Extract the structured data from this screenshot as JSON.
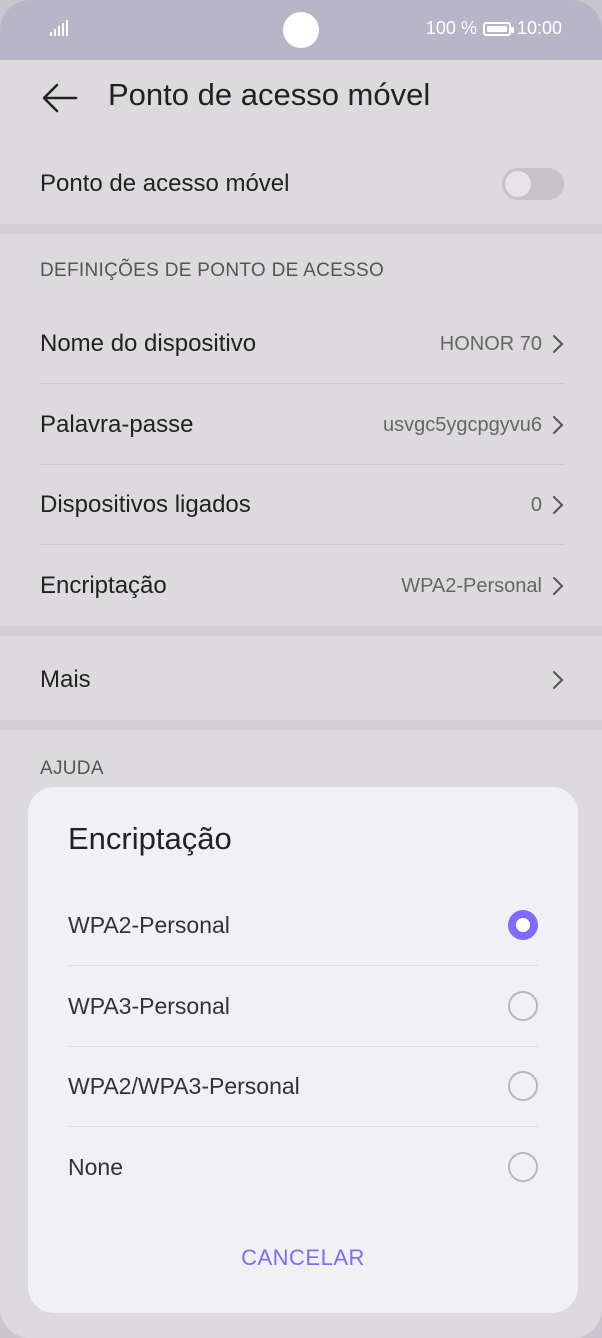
{
  "status": {
    "battery": "100 %",
    "time": "10:00"
  },
  "appbar": {
    "title": "Ponto de acesso móvel"
  },
  "hotspot": {
    "label": "Ponto de acesso móvel",
    "enabled": false
  },
  "settings": {
    "section_title": "DEFINIÇÕES DE PONTO DE ACESSO",
    "items": [
      {
        "label": "Nome do dispositivo",
        "value": "HONOR 70"
      },
      {
        "label": "Palavra-passe",
        "value": "usvgc5ygcpgyvu6"
      },
      {
        "label": "Dispositivos ligados",
        "value": "0"
      },
      {
        "label": "Encriptação",
        "value": "WPA2-Personal"
      }
    ]
  },
  "more": {
    "label": "Mais"
  },
  "help": {
    "section_title": "AJUDA"
  },
  "dialog": {
    "title": "Encriptação",
    "options": [
      {
        "label": "WPA2-Personal",
        "selected": true
      },
      {
        "label": "WPA3-Personal",
        "selected": false
      },
      {
        "label": "WPA2/WPA3-Personal",
        "selected": false
      },
      {
        "label": "None",
        "selected": false
      }
    ],
    "cancel_label": "CANCELAR"
  },
  "colors": {
    "accent": "#7e6cff",
    "statusbar": "#b7b5c7"
  },
  "icons": [
    "signal-icon",
    "battery-icon",
    "back-arrow-icon",
    "chevron-right-icon",
    "radio-icon"
  ]
}
